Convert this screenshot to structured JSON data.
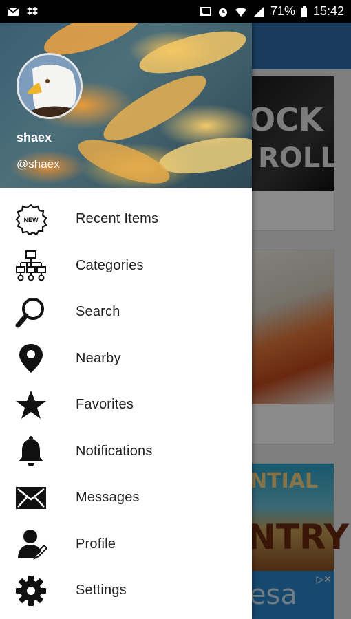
{
  "status_bar": {
    "battery": "71%",
    "time": "15:42"
  },
  "user": {
    "name": "shaex",
    "handle": "@shaex"
  },
  "menu": {
    "items": [
      {
        "label": "Recent Items",
        "icon": "new-badge-icon"
      },
      {
        "label": "Categories",
        "icon": "sitemap-icon"
      },
      {
        "label": "Search",
        "icon": "search-icon"
      },
      {
        "label": "Nearby",
        "icon": "map-pin-icon"
      },
      {
        "label": "Favorites",
        "icon": "star-icon"
      },
      {
        "label": "Notifications",
        "icon": "bell-icon"
      },
      {
        "label": "Messages",
        "icon": "envelope-icon"
      },
      {
        "label": "Profile",
        "icon": "user-edit-icon"
      },
      {
        "label": "Settings",
        "icon": "gear-icon"
      }
    ],
    "new_badge_text": "NEW"
  },
  "background": {
    "card1_text_a": "OCK",
    "card1_text_b": "ROLL",
    "card3_text_a": "NTIAL",
    "card3_text_b": "NTRY",
    "ad_text": "esa"
  },
  "colors": {
    "toolbar": "#2f6fae",
    "drawer": "#ffffff",
    "text": "#222222"
  }
}
